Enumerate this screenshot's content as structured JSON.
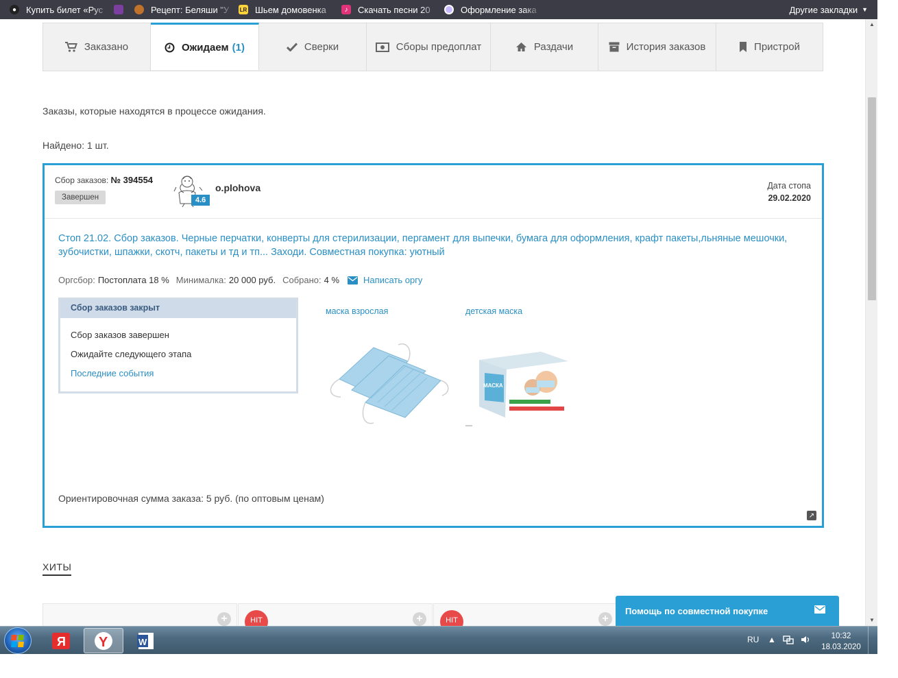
{
  "bookmarks": {
    "items": [
      {
        "label": "Купить билет «Рус",
        "color": "#222222",
        "icon": "drop-icon"
      },
      {
        "label": "",
        "color": "#7b3fa0",
        "icon": "flag-icon"
      },
      {
        "label": "Рецепт: Беляши \"У",
        "color": "#c0722b",
        "icon": "burger-icon"
      },
      {
        "label": "Шьем домовенка",
        "color": "#ffd43b",
        "icon": "lr-icon"
      },
      {
        "label": "Скачать песни 20",
        "color": "#e0347a",
        "icon": "music-icon"
      },
      {
        "label": "Оформление зака",
        "color": "#c8b8ff",
        "icon": "circle-icon"
      }
    ],
    "other_label": "Другие закладки"
  },
  "tabs": [
    {
      "label": "Заказано",
      "icon": "cart-icon"
    },
    {
      "label": "Ожидаем",
      "count": "(1)",
      "icon": "clock-icon",
      "active": true
    },
    {
      "label": "Сверки",
      "icon": "check-icon"
    },
    {
      "label": "Сборы предоплат",
      "icon": "money-icon"
    },
    {
      "label": "Раздачи",
      "icon": "home-icon"
    },
    {
      "label": "История заказов",
      "icon": "archive-icon"
    },
    {
      "label": "Пристрой",
      "icon": "bookmark-icon"
    }
  ],
  "page": {
    "intro": "Заказы, которые находятся в процессе ожидания.",
    "found": "Найдено: 1 шт."
  },
  "order": {
    "sbor_label": "Сбор заказов:",
    "sbor_number": "№ 394554",
    "status": "Завершен",
    "rating": "4.6",
    "organizer": "o.plohova",
    "date_label": "Дата стопа",
    "date_value": "29.02.2020",
    "description": "Стоп 21.02. Сбор заказов. Черные перчатки, конверты для стерилизации, пергамент для выпечки, бумага для оформления, крафт пакеты,льняные мешочки, зубочистки, шпажки, скотч, пакеты и тд и тп... Заходи. Совместная покупка: уютный",
    "orgsbor_label": "Оргсбор:",
    "orgsbor_value": "Постоплата 18 %",
    "min_label": "Минималка:",
    "min_value": "20 000 руб.",
    "collected_label": "Собрано:",
    "collected_value": "4 %",
    "write_org": "Написать оргу",
    "closed_header": "Сбор заказов закрыт",
    "closed_line1": "Сбор заказов завершен",
    "closed_line2": "Ожидайте следующего этапа",
    "closed_link": "Последние события",
    "products": [
      {
        "name": "маска взрослая"
      },
      {
        "name": "детская маска"
      }
    ],
    "box_text": "МАСКА",
    "total": "Ориентировочная сумма заказа: 5 руб. (по оптовым ценам)"
  },
  "hits": {
    "title": "ХИТЫ",
    "badge": "HIT"
  },
  "help": {
    "label": "Помощь по совместной покупке"
  },
  "taskbar": {
    "lang": "RU",
    "time": "10:32",
    "date": "18.03.2020"
  },
  "colors": {
    "accent": "#2a9fd6",
    "link": "#2a8fc4",
    "hit": "#e84a4a"
  }
}
